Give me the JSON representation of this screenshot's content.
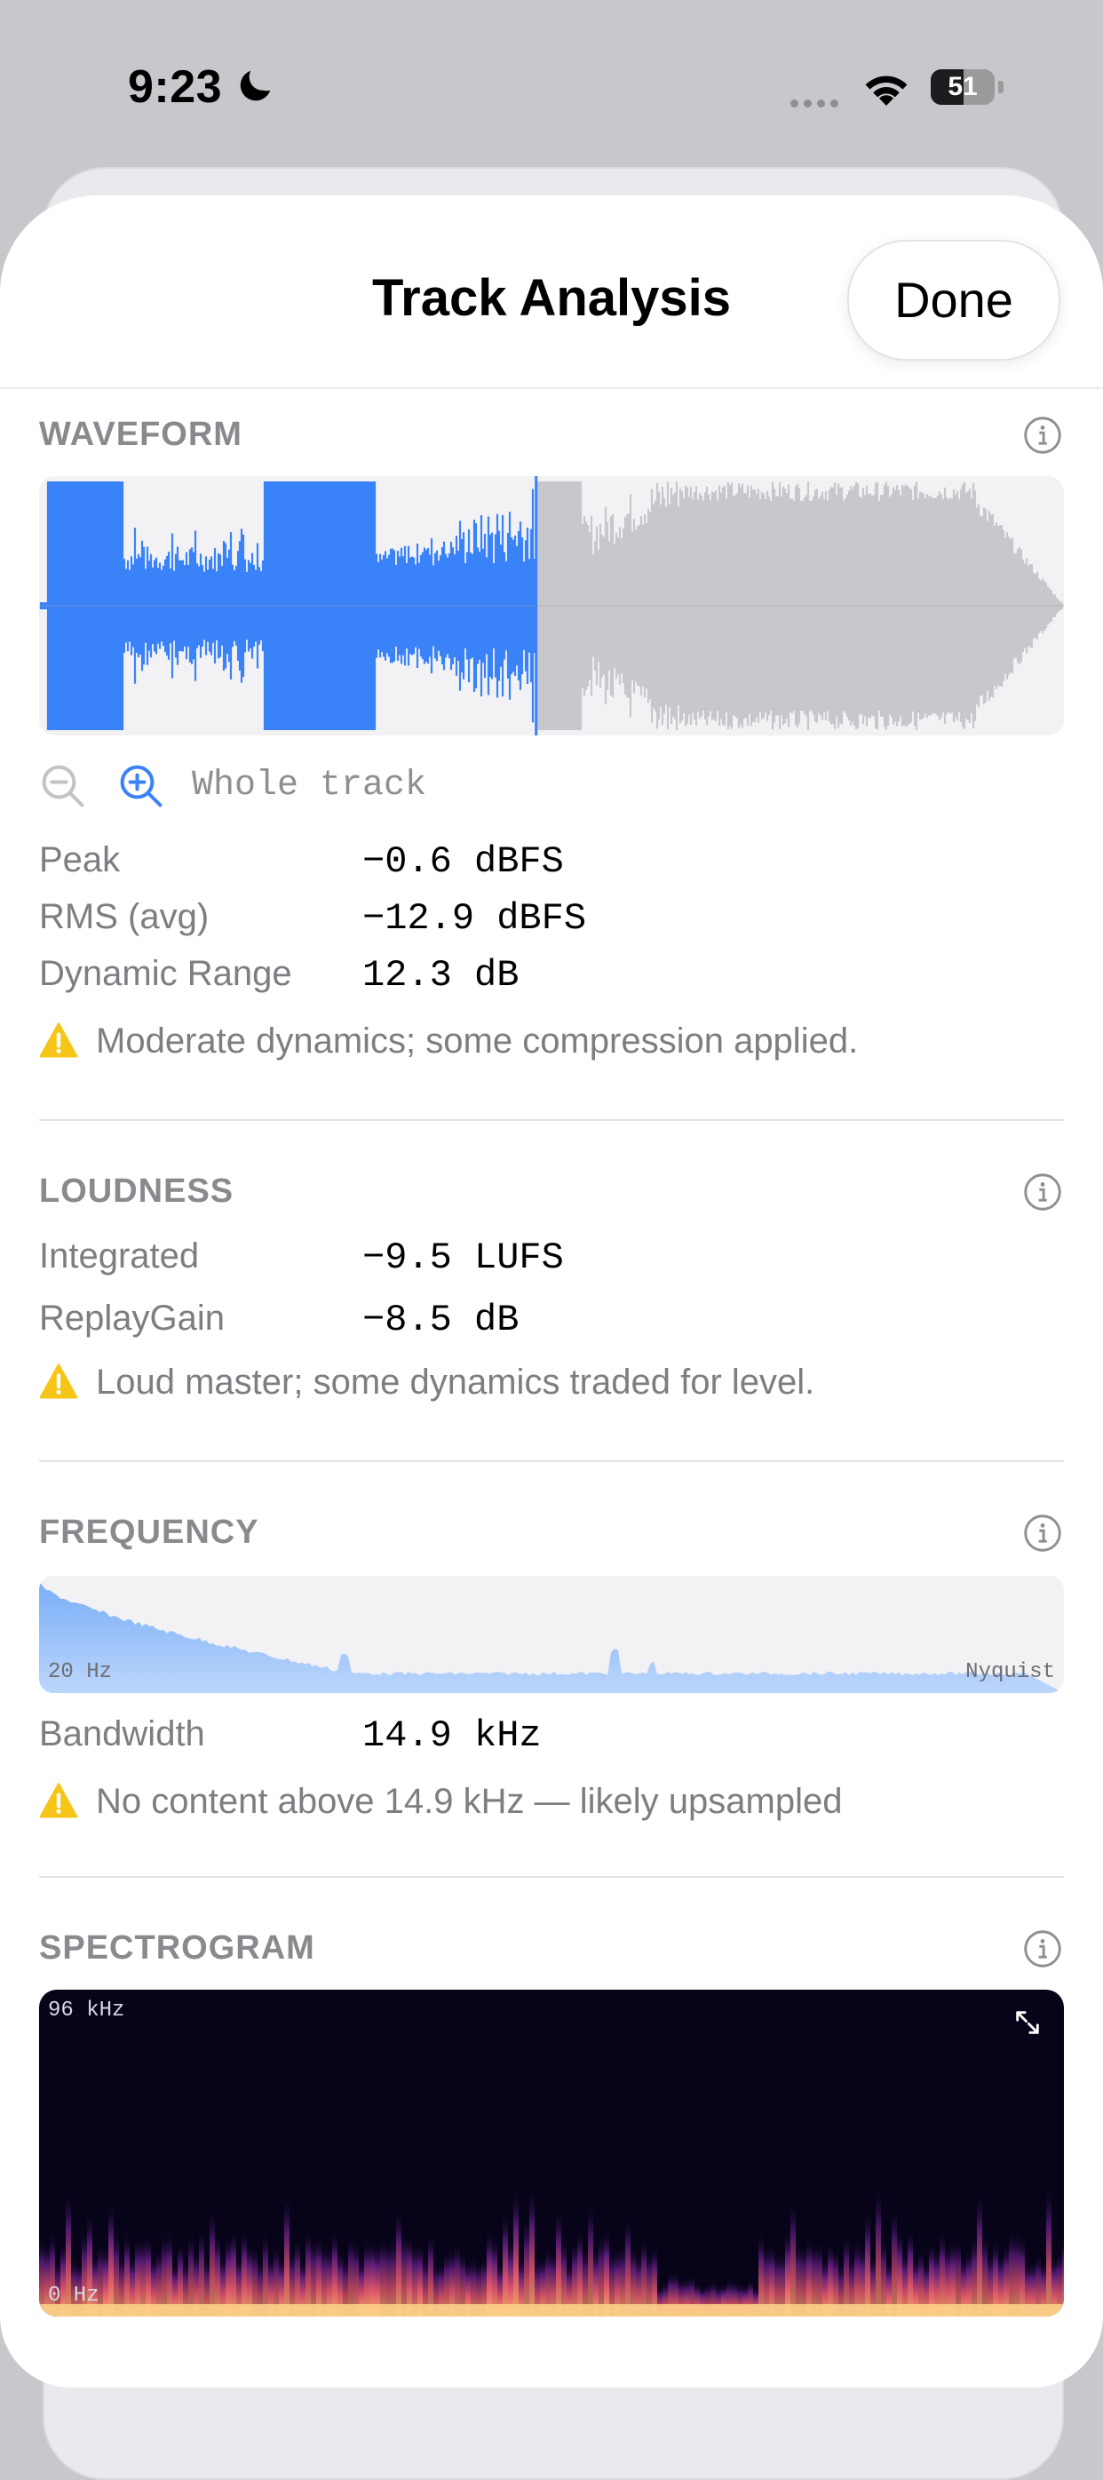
{
  "status_bar": {
    "time": "9:23",
    "battery": "51",
    "battery_level": 0.51
  },
  "sheet": {
    "title": "Track Analysis",
    "done_label": "Done"
  },
  "waveform": {
    "title": "WAVEFORM",
    "playhead_fraction": 0.485,
    "zoom_label": "Whole track",
    "stats": [
      {
        "label": "Peak",
        "value": "−0.6 dBFS"
      },
      {
        "label": "RMS (avg)",
        "value": "−12.9 dBFS"
      },
      {
        "label": "Dynamic Range",
        "value": "12.3 dB"
      }
    ],
    "note": "Moderate dynamics; some compression applied."
  },
  "loudness": {
    "title": "LOUDNESS",
    "stats": [
      {
        "label": "Integrated",
        "value": "−9.5 LUFS"
      },
      {
        "label": "ReplayGain",
        "value": "−8.5 dB"
      }
    ],
    "note": "Loud master; some dynamics traded for level."
  },
  "frequency": {
    "title": "FREQUENCY",
    "x_start_label": "20 Hz",
    "x_end_label": "Nyquist",
    "stats": [
      {
        "label": "Bandwidth",
        "value": "14.9 kHz"
      }
    ],
    "note": "No content above 14.9 kHz — likely upsampled"
  },
  "spectrogram": {
    "title": "SPECTROGRAM",
    "top_label": "96 kHz",
    "bottom_label": "0 Hz"
  },
  "colors": {
    "accent": "#3a82f7",
    "warning": "#f5c518",
    "waveform_unplayed": "#c7c7cc"
  }
}
